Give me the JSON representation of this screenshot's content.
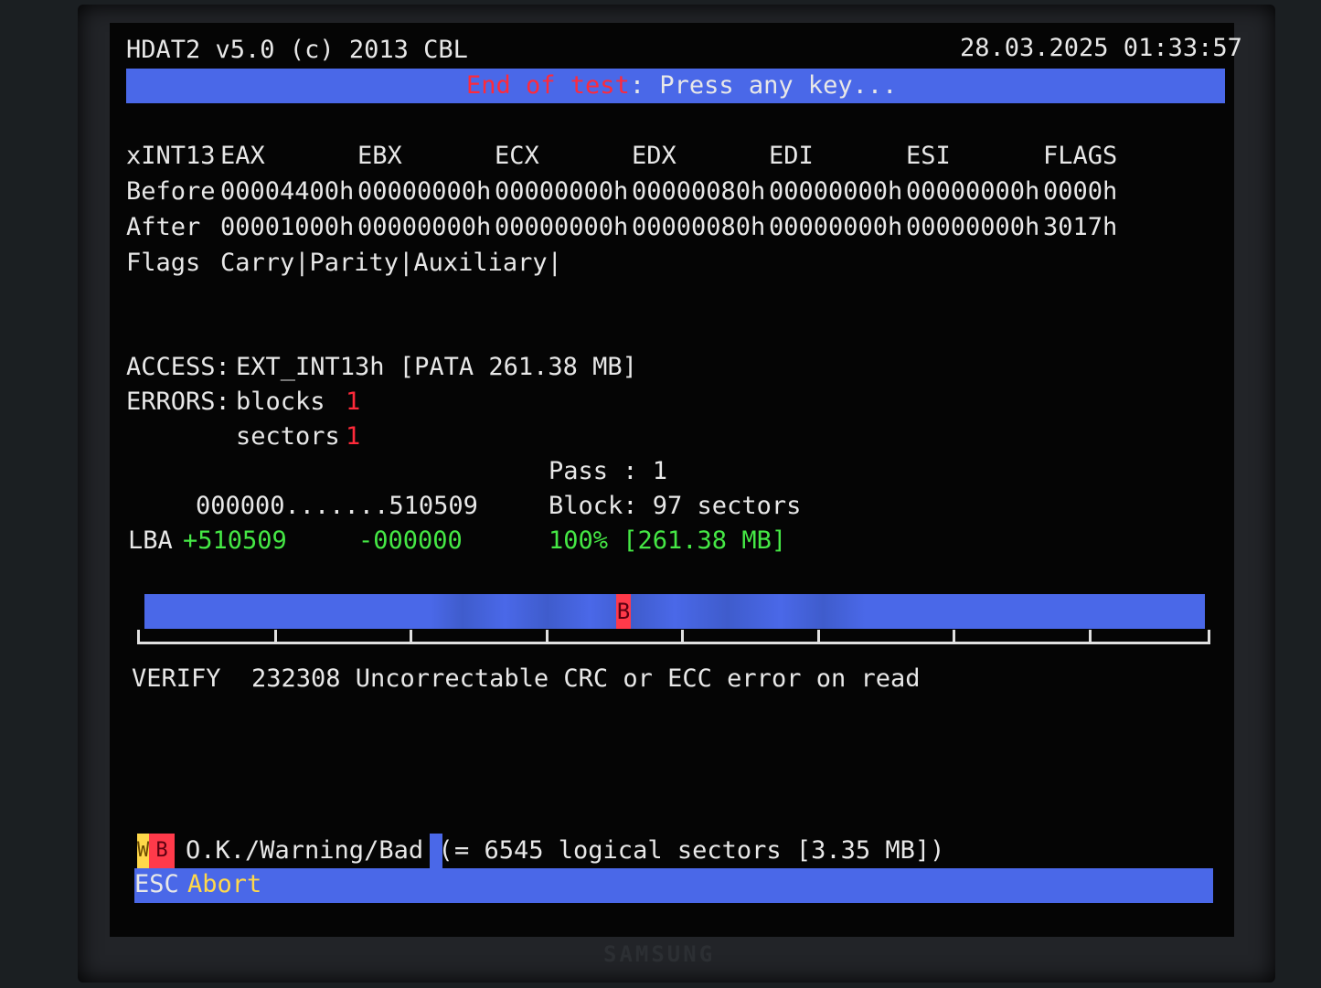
{
  "header": {
    "app_title": "HDAT2 v5.0 (c) 2013 CBL",
    "datetime": "28.03.2025 01:33:57",
    "status_red": "End of test",
    "status_white": ": Press any key..."
  },
  "registers": {
    "headers": [
      "xINT13",
      "EAX",
      "EBX",
      "ECX",
      "EDX",
      "EDI",
      "ESI",
      "FLAGS"
    ],
    "before": [
      "Before",
      "00004400h",
      "00000000h",
      "00000000h",
      "00000080h",
      "00000000h",
      "00000000h",
      "0000h"
    ],
    "after": [
      "After",
      "00001000h",
      "00000000h",
      "00000000h",
      "00000080h",
      "00000000h",
      "00000000h",
      "3017h"
    ],
    "flags_label": "Flags",
    "flags_value": "Carry|Parity|Auxiliary|"
  },
  "access": {
    "label": "ACCESS:",
    "value": "EXT_INT13h [PATA 261.38 MB]"
  },
  "errors": {
    "label": "ERRORS:",
    "blocks_label": "blocks",
    "blocks_value": "1",
    "sectors_label": "sectors",
    "sectors_value": "1"
  },
  "progress": {
    "pass_text": "Pass : 1",
    "block_text": "Block: 97 sectors",
    "range_text": "000000.......510509",
    "lba_label": "LBA",
    "lba_plus": "+510509",
    "lba_minus": "-000000",
    "percent_text": "100% [261.38 MB]",
    "bar_fraction": 1.0,
    "bad_marker_glyph": "B"
  },
  "log": {
    "op": "VERIFY",
    "message": "232308 Uncorrectable CRC or ECC error on read"
  },
  "legend": {
    "w_glyph": "W",
    "b_glyph": "B",
    "text_before": "O.K./Warning/Bad (",
    "text_after": "= 6545 logical sectors [3.35 MB])"
  },
  "footer": {
    "key": "ESC",
    "action": "Abort"
  },
  "monitor": {
    "brand": "SAMSUNG"
  },
  "colors": {
    "bar_blue": "#4a68e8",
    "error_red": "#ff2a3a",
    "ok_green": "#45e845",
    "warn_yellow": "#ffd84a"
  }
}
